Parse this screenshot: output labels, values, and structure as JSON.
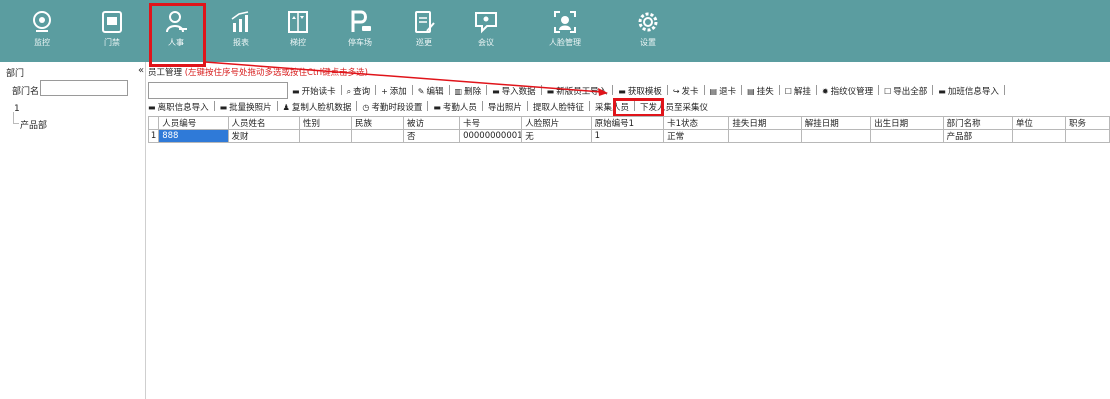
{
  "nav": {
    "items": [
      {
        "label": "监控",
        "icon": "camera-icon"
      },
      {
        "label": "门禁",
        "icon": "door-access-icon"
      },
      {
        "label": "人事",
        "icon": "person-icon",
        "active": true
      },
      {
        "label": "报表",
        "icon": "bar-report-icon"
      },
      {
        "label": "梯控",
        "icon": "elevator-icon"
      },
      {
        "label": "停车场",
        "icon": "parking-icon"
      },
      {
        "label": "巡更",
        "icon": "patrol-icon"
      },
      {
        "label": "会议",
        "icon": "meeting-icon"
      },
      {
        "label": "人脸管理",
        "icon": "face-icon"
      },
      {
        "label": "设置",
        "icon": "gear-icon"
      }
    ]
  },
  "left_panel": {
    "title": "部门",
    "filter_label": "部门名",
    "filter_value": "",
    "tree_root": "1",
    "tree_child": "产品部"
  },
  "breadcrumb": {
    "collapse": "«",
    "title": "员工管理",
    "hint": "(左键按住序号处拖动多选或按住Ctrl键点击多选)"
  },
  "toolbar1": [
    {
      "label": "开始读卡",
      "icon": "card-icon"
    },
    {
      "label": "查询",
      "icon": "search-icon"
    },
    {
      "label": "添加",
      "icon": "plus-icon"
    },
    {
      "label": "编辑",
      "icon": "edit-icon"
    },
    {
      "label": "删除",
      "icon": "trash-icon"
    },
    {
      "label": "导入数据",
      "icon": "import-icon"
    },
    {
      "label": "新版员工导入",
      "icon": "import-icon"
    },
    {
      "label": "获取模板",
      "icon": "template-icon"
    },
    {
      "label": "发卡",
      "icon": "issue-card-icon"
    },
    {
      "label": "退卡",
      "icon": "return-card-icon"
    },
    {
      "label": "挂失",
      "icon": "lost-card-icon"
    },
    {
      "label": "解挂",
      "icon": "unlock-card-icon"
    },
    {
      "label": "指纹仪管理",
      "icon": "fingerprint-icon"
    },
    {
      "label": "导出全部",
      "icon": "export-icon"
    },
    {
      "label": "加班信息导入",
      "icon": "import-icon"
    }
  ],
  "toolbar2": [
    {
      "label": "离职信息导入",
      "icon": "import-icon"
    },
    {
      "label": "批量换照片",
      "icon": "photo-icon"
    },
    {
      "label": "复制人脸机数据",
      "icon": "copy-face-icon"
    },
    {
      "label": "考勤时段设置",
      "icon": "clock-icon"
    },
    {
      "label": "考勤人员",
      "icon": "attendance-icon"
    },
    {
      "label": "导出照片",
      "icon": ""
    },
    {
      "label": "提取人脸特征",
      "icon": ""
    },
    {
      "label": "采集人员",
      "icon": ""
    },
    {
      "label": "下发人员至采集仪",
      "icon": ""
    }
  ],
  "table": {
    "columns": [
      "人员编号",
      "人员姓名",
      "性别",
      "民族",
      "被访",
      "卡号",
      "人脸照片",
      "原始编号1",
      "卡1状态",
      "挂失日期",
      "解挂日期",
      "出生日期",
      "部门名称",
      "单位",
      "职务"
    ],
    "rows": [
      {
        "no": "1",
        "cells": [
          "888",
          "发财",
          "",
          "",
          "否",
          "00000000001",
          "无",
          "1",
          "正常",
          "",
          "",
          "",
          "产品部",
          "",
          ""
        ]
      }
    ]
  },
  "colors": {
    "topbar": "#5b9da0",
    "highlight": "#e0141a",
    "selected_cell": "#2f7ad8"
  }
}
